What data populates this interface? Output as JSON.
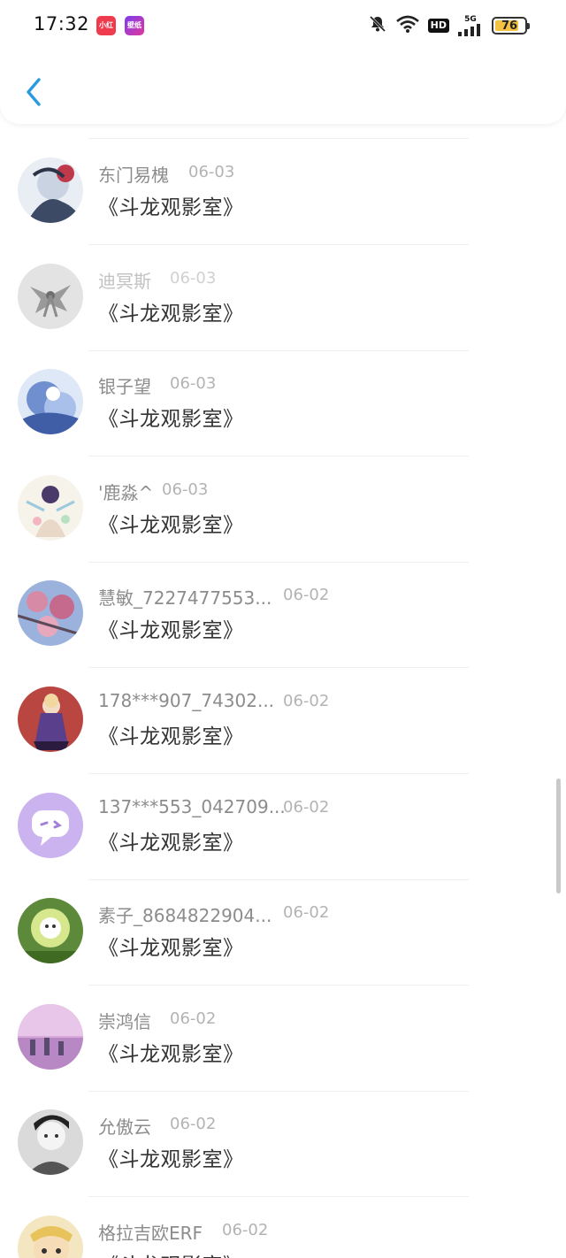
{
  "status_bar": {
    "time": "17:32",
    "badges": [
      "小红书",
      "壁纸"
    ],
    "battery": "76",
    "network": "5G",
    "hd": "HD"
  },
  "header": {
    "back_icon": "chevron-left-icon",
    "accent": "#2a9ae0"
  },
  "comments": [
    {
      "name": "东门易槐",
      "date": "06-03",
      "content": "《斗龙观影室》"
    },
    {
      "name": "迪冥斯",
      "date": "06-03",
      "content": "《斗龙观影室》"
    },
    {
      "name": "银子望",
      "date": "06-03",
      "content": "《斗龙观影室》"
    },
    {
      "name": "'鹿淼^",
      "date": "06-03",
      "content": "《斗龙观影室》"
    },
    {
      "name": "慧敏_7227477553...",
      "date": "06-02",
      "content": "《斗龙观影室》"
    },
    {
      "name": "178***907_74302...",
      "date": "06-02",
      "content": "《斗龙观影室》"
    },
    {
      "name": "137***553_042709...",
      "date": "06-02",
      "content": "《斗龙观影室》"
    },
    {
      "name": "素子_8684822904...",
      "date": "06-02",
      "content": "《斗龙观影室》"
    },
    {
      "name": "崇鸿信",
      "date": "06-02",
      "content": "《斗龙观影室》"
    },
    {
      "name": "允傲云",
      "date": "06-02",
      "content": "《斗龙观影室》"
    },
    {
      "name": "格拉吉欧ERF",
      "date": "06-02",
      "content": "《斗龙观影室》"
    }
  ]
}
